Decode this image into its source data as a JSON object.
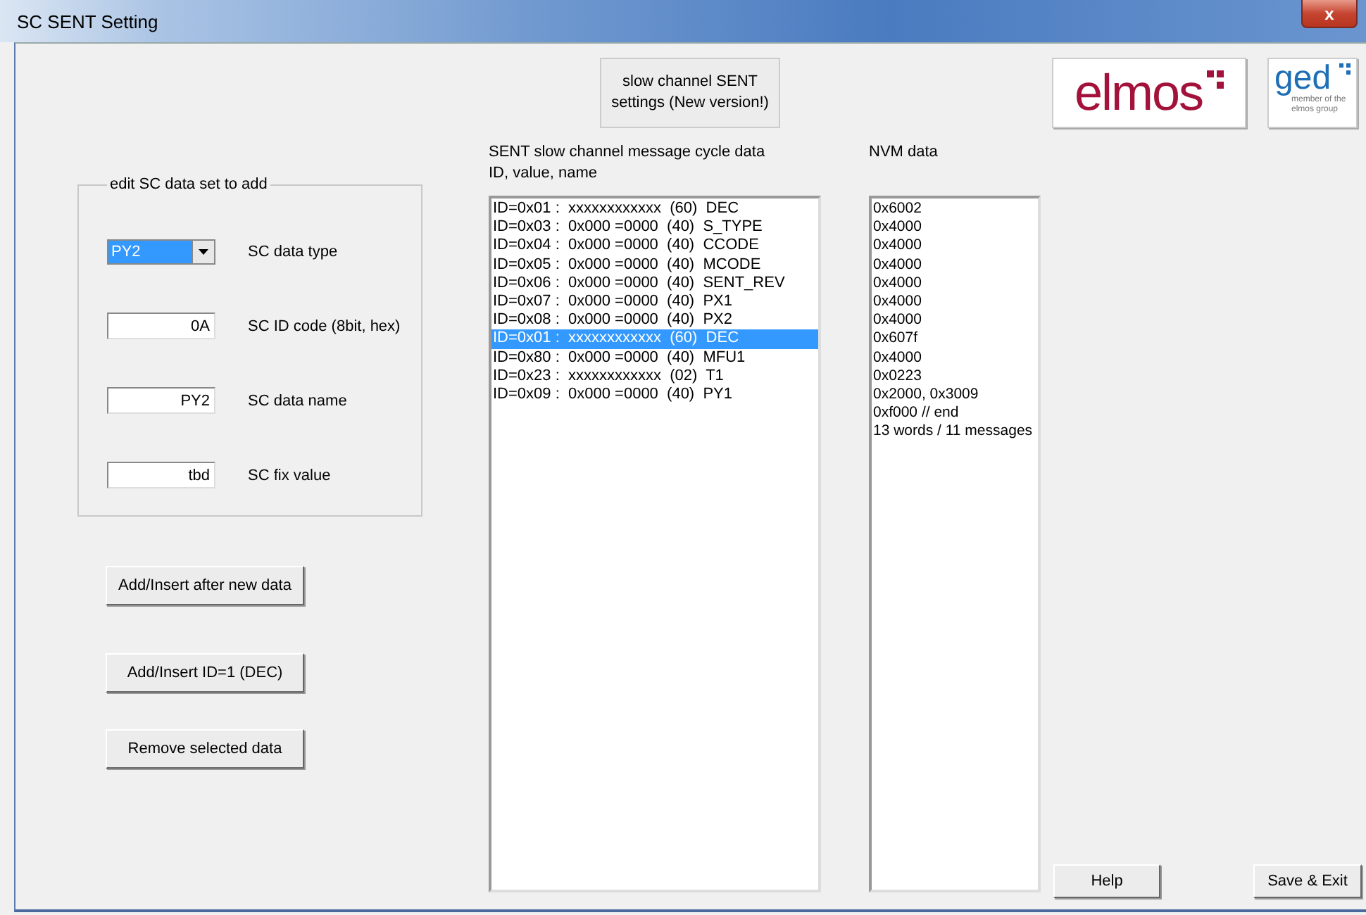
{
  "window": {
    "title": "SC SENT Setting",
    "close_label": "x"
  },
  "header_button": "slow channel SENT settings (New version!)",
  "logos": {
    "elmos": "elmos",
    "ged": "ged",
    "ged_tagline": "member of the elmos group"
  },
  "edit_group": {
    "legend": "edit SC data set to add",
    "fields": [
      {
        "kind": "dropdown",
        "value": "PY2",
        "label": "SC data type"
      },
      {
        "kind": "text",
        "value": "0A",
        "label": "SC ID code (8bit, hex)"
      },
      {
        "kind": "text",
        "value": "PY2",
        "label": "SC data name"
      },
      {
        "kind": "text",
        "value": "tbd",
        "label": "SC fix value"
      }
    ]
  },
  "action_buttons": [
    "Add/Insert after new data",
    "Add/Insert  ID=1 (DEC)",
    "Remove selected data"
  ],
  "message_list": {
    "heading": "SENT slow channel message cycle data",
    "subheading": "ID, value, name",
    "rows": [
      {
        "text": "ID=0x01 :  xxxxxxxxxxxx  (60)  DEC",
        "selected": false
      },
      {
        "text": "ID=0x03 :  0x000 =0000  (40)  S_TYPE",
        "selected": false
      },
      {
        "text": "ID=0x04 :  0x000 =0000  (40)  CCODE",
        "selected": false
      },
      {
        "text": "ID=0x05 :  0x000 =0000  (40)  MCODE",
        "selected": false
      },
      {
        "text": "ID=0x06 :  0x000 =0000  (40)  SENT_REV",
        "selected": false
      },
      {
        "text": "ID=0x07 :  0x000 =0000  (40)  PX1",
        "selected": false
      },
      {
        "text": "ID=0x08 :  0x000 =0000  (40)  PX2",
        "selected": false
      },
      {
        "text": "ID=0x01 :  xxxxxxxxxxxx  (60)  DEC",
        "selected": true
      },
      {
        "text": "ID=0x80 :  0x000 =0000  (40)  MFU1",
        "selected": false
      },
      {
        "text": "ID=0x23 :  xxxxxxxxxxxx  (02)  T1",
        "selected": false
      },
      {
        "text": "ID=0x09 :  0x000 =0000  (40)  PY1",
        "selected": false
      }
    ]
  },
  "nvm": {
    "heading": "NVM data",
    "lines": [
      "0x6002",
      "0x4000",
      "0x4000",
      "0x4000",
      "0x4000",
      "0x4000",
      "0x4000",
      "0x607f",
      "0x4000",
      "0x0223",
      "0x2000, 0x3009",
      "0xf000 // end",
      "13 words / 11 messages"
    ]
  },
  "footer_buttons": [
    "Help",
    "Save & Exit"
  ]
}
